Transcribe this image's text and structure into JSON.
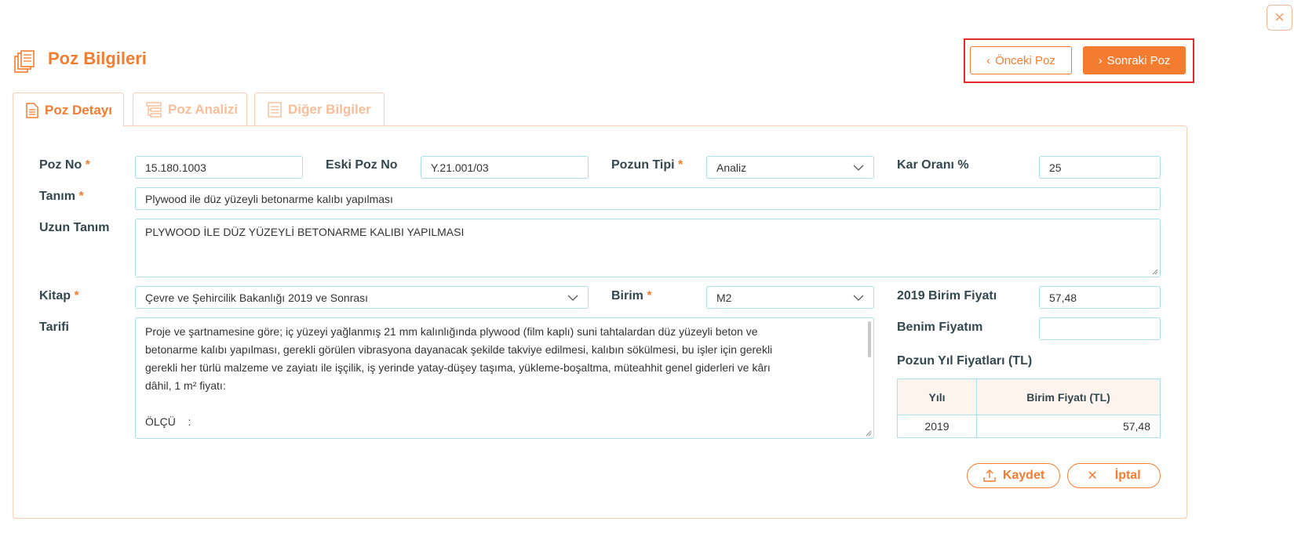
{
  "header": {
    "title": "Poz Bilgileri",
    "prev_label": "Önceki Poz",
    "next_label": "Sonraki Poz"
  },
  "tabs": [
    {
      "label": "Poz Detayı"
    },
    {
      "label": "Poz Analizi"
    },
    {
      "label": "Diğer Bilgiler"
    }
  ],
  "form": {
    "poz_no": {
      "label": "Poz No",
      "required": "*",
      "value": "15.180.1003"
    },
    "eski_poz_no": {
      "label": "Eski Poz No",
      "value": "Y.21.001/03"
    },
    "pozun_tipi": {
      "label": "Pozun Tipi",
      "required": "*",
      "value": "Analiz"
    },
    "kar_orani": {
      "label": "Kar Oranı %",
      "value": "25"
    },
    "tanim": {
      "label": "Tanım",
      "required": "*",
      "value": "Plywood ile düz yüzeyli betonarme kalıbı yapılması"
    },
    "uzun_tanim": {
      "label": "Uzun Tanım",
      "value": "PLYWOOD İLE DÜZ YÜZEYLİ BETONARME KALIBI YAPILMASI"
    },
    "kitap": {
      "label": "Kitap",
      "required": "*",
      "value": "Çevre ve Şehircilik Bakanlığı 2019 ve Sonrası"
    },
    "birim": {
      "label": "Birim",
      "required": "*",
      "value": "M2"
    },
    "birim_fiyati": {
      "label": "2019 Birim Fiyatı",
      "value": "57,48"
    },
    "benim_fiyatim": {
      "label": "Benim Fiyatım",
      "value": ""
    },
    "tarifi": {
      "label": "Tarifi",
      "lines": [
        "Proje ve şartnamesine göre; iç yüzeyi yağlanmış 21 mm kalınlığında plywood (film kaplı) suni tahtalardan düz yüzeyli beton ve",
        "betonarme kalıbı yapılması, gerekli görülen vibrasyona dayanacak şekilde takviye edilmesi, kalıbın sökülmesi, bu işler için gerekli",
        "gerekli her türlü malzeme ve zayiatı ile işçilik, iş yerinde yatay-düşey taşıma, yükleme-boşaltma, müteahhit genel giderleri ve kârı",
        "dâhil, 1 m² fiyatı:",
        "",
        "ÖLÇÜ    :"
      ]
    }
  },
  "yil_fiyatlari": {
    "title": "Pozun Yıl Fiyatları (TL)",
    "columns": [
      "Yılı",
      "Birim Fiyatı (TL)"
    ],
    "rows": [
      [
        "2019",
        "57,48"
      ]
    ]
  },
  "actions": {
    "save_label": "Kaydet",
    "cancel_label": "İptal"
  },
  "colors": {
    "accent": "#f47c30",
    "border": "#a9dfe6",
    "highlight": "#e32b2b"
  }
}
